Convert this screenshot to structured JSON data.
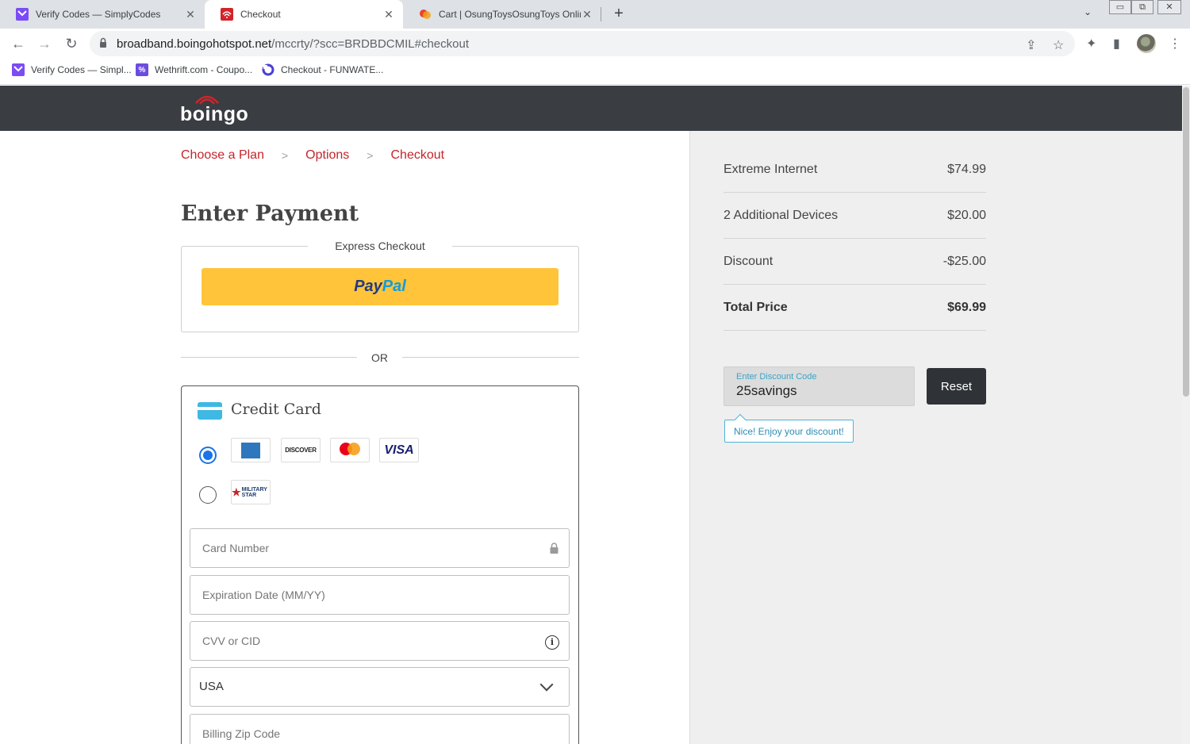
{
  "browser": {
    "tabs": [
      {
        "title": "Verify Codes — SimplyCodes",
        "active": false
      },
      {
        "title": "Checkout",
        "active": true
      },
      {
        "title": "Cart | OsungToysOsungToys Online",
        "active": false
      }
    ],
    "url_host": "broadband.boingohotspot.net",
    "url_rest": "/mccrty/?scc=BRDBDCMIL#checkout",
    "bookmarks": [
      {
        "label": "Verify Codes — Simpl..."
      },
      {
        "label": "Wethrift.com - Coupo..."
      },
      {
        "label": "Checkout - FUNWATE..."
      }
    ],
    "colors": {
      "tab_strip": "#dee1e6",
      "simplycodes_fav": "#7b4cf5",
      "boingo_fav": "#d2232a"
    }
  },
  "site": {
    "logo_text": "boingo",
    "breadcrumbs": [
      "Choose a Plan",
      "Options",
      "Checkout"
    ],
    "page_title": "Enter Payment",
    "express_checkout_label": "Express Checkout",
    "paypal": {
      "pay": "Pay",
      "pal": "Pal"
    },
    "or_label": "OR",
    "credit_card": {
      "title": "Credit Card",
      "card_brands": [
        "American Express",
        "DISCOVER",
        "mastercard",
        "VISA"
      ],
      "alt_brand": "MILITARY STAR",
      "card_number_placeholder": "Card Number",
      "expiration_placeholder": "Expiration Date (MM/YY)",
      "cvv_placeholder": "CVV or CID",
      "country_value": "USA",
      "zip_placeholder": "Billing Zip Code"
    },
    "colors": {
      "header_bg": "#3a3d42",
      "accent_red": "#c4252a",
      "paypal_yellow": "#ffc439",
      "summary_bg": "#efefef"
    }
  },
  "summary": {
    "items": [
      {
        "label": "Extreme Internet",
        "amount": "$74.99"
      },
      {
        "label": "2 Additional Devices",
        "amount": "$20.00"
      },
      {
        "label": "Discount",
        "amount": "-$25.00"
      }
    ],
    "total_label": "Total Price",
    "total_amount": "$69.99",
    "discount_code_label": "Enter Discount Code",
    "discount_code_value": "25savings",
    "reset_label": "Reset",
    "success_message": "Nice! Enjoy your discount!"
  }
}
